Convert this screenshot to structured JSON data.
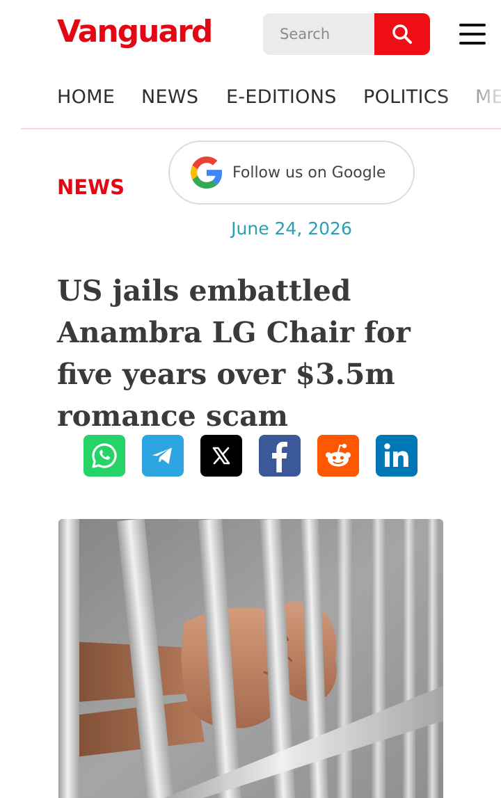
{
  "header": {
    "logo_text": "Vanguard",
    "search_placeholder": "Search",
    "search_icon": "search-icon",
    "menu_icon": "hamburger-menu-icon"
  },
  "nav": {
    "items": [
      "HOME",
      "NEWS",
      "E-EDITIONS",
      "POLITICS",
      "ME"
    ]
  },
  "article": {
    "category": "NEWS",
    "follow_label": "Follow us on Google",
    "date": "June 24, 2026",
    "headline": "US jails embattled Anambra LG Chair for five years over $3.5m romance scam"
  },
  "share": {
    "buttons": [
      {
        "icon": "whatsapp-icon",
        "color": "#25d366"
      },
      {
        "icon": "telegram-icon",
        "color": "#2ca5e0"
      },
      {
        "icon": "x-icon",
        "color": "#000000"
      },
      {
        "icon": "facebook-icon",
        "color": "#3b5998"
      },
      {
        "icon": "reddit-icon",
        "color": "#ff5700"
      },
      {
        "icon": "linkedin-icon",
        "color": "#0077b5"
      }
    ]
  },
  "colors": {
    "brand_red": "#e30613",
    "date_teal": "#2a9fb0"
  }
}
